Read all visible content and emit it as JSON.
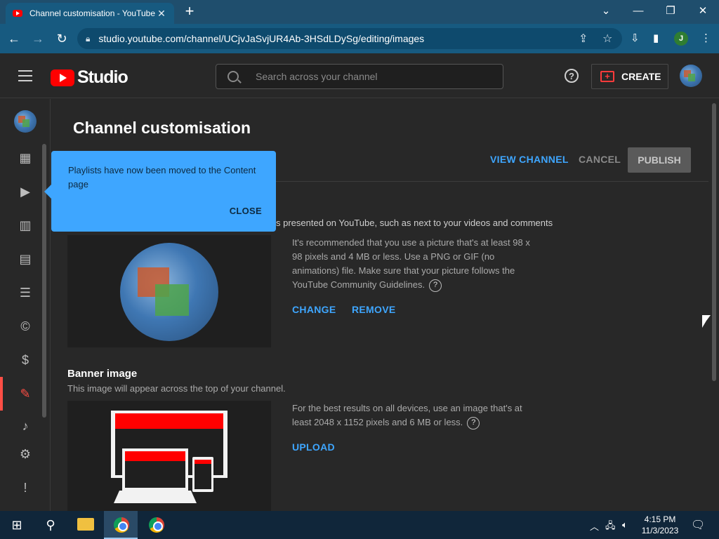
{
  "browser": {
    "tab_title": "Channel customisation - YouTube Studio",
    "url": "studio.youtube.com/channel/UCjvJaSvjUR4Ab-3HSdLDySg/editing/images",
    "profile_initial": "J"
  },
  "header": {
    "logo_text": "Studio",
    "search_placeholder": "Search across your channel",
    "help_label": "?",
    "create_label": "CREATE"
  },
  "page": {
    "title": "Channel customisation",
    "view_channel": "VIEW CHANNEL",
    "cancel": "CANCEL",
    "publish": "PUBLISH"
  },
  "picture": {
    "description_visible": "s presented on YouTube, such as next to your videos and comments",
    "info": "It's recommended that you use a picture that's at least 98 x 98 pixels and 4 MB or less. Use a PNG or GIF (no animations) file. Make sure that your picture follows the YouTube Community Guidelines.",
    "change": "CHANGE",
    "remove": "REMOVE"
  },
  "banner": {
    "title": "Banner image",
    "description": "This image will appear across the top of your channel.",
    "info": "For the best results on all devices, use an image that's at least 2048 x 1152 pixels and 6 MB or less.",
    "upload": "UPLOAD"
  },
  "tooltip": {
    "message": "Playlists have now been moved to the Content page",
    "close": "CLOSE"
  },
  "taskbar": {
    "time": "4:15 PM",
    "date": "11/3/2023"
  },
  "colors": {
    "accent_blue": "#3ea6ff",
    "youtube_red": "#ff0000",
    "background": "#282828"
  }
}
